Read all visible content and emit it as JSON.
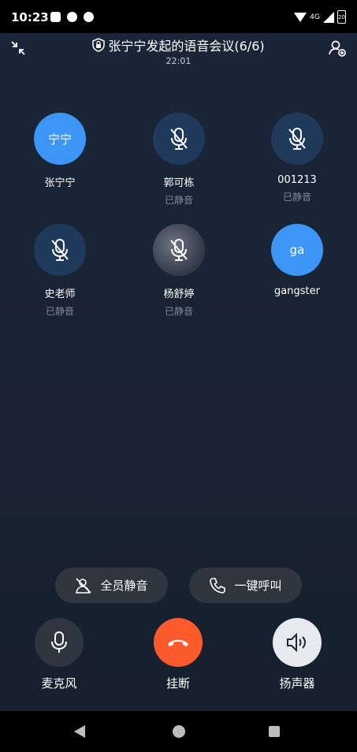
{
  "status_bar": {
    "time": "10:23",
    "network": "4G",
    "battery_text": "20"
  },
  "header": {
    "title": "张宁宁发起的语音会议(6/6)",
    "duration": "22:01"
  },
  "participants": [
    {
      "name": "张宁宁",
      "avatar_text": "宁宁",
      "status": "",
      "muted": false
    },
    {
      "name": "郭可栋",
      "avatar_text": "",
      "status": "已静音",
      "muted": true
    },
    {
      "name": "001213",
      "avatar_text": "",
      "status": "已静音",
      "muted": true
    },
    {
      "name": "史老师",
      "avatar_text": "",
      "status": "已静音",
      "muted": true
    },
    {
      "name": "杨舒婷",
      "avatar_text": "",
      "status": "已静音",
      "muted": true
    },
    {
      "name": "gangster",
      "avatar_text": "ga",
      "status": "",
      "muted": false
    }
  ],
  "actions": {
    "mute_all": "全员静音",
    "call_all": "一键呼叫"
  },
  "controls": {
    "mic": "麦克风",
    "hangup": "挂断",
    "speaker": "扬声器"
  },
  "colors": {
    "accent_blue": "#3d96f5",
    "hangup_orange": "#ff5a2c",
    "muted_avatar": "#203a5c"
  }
}
